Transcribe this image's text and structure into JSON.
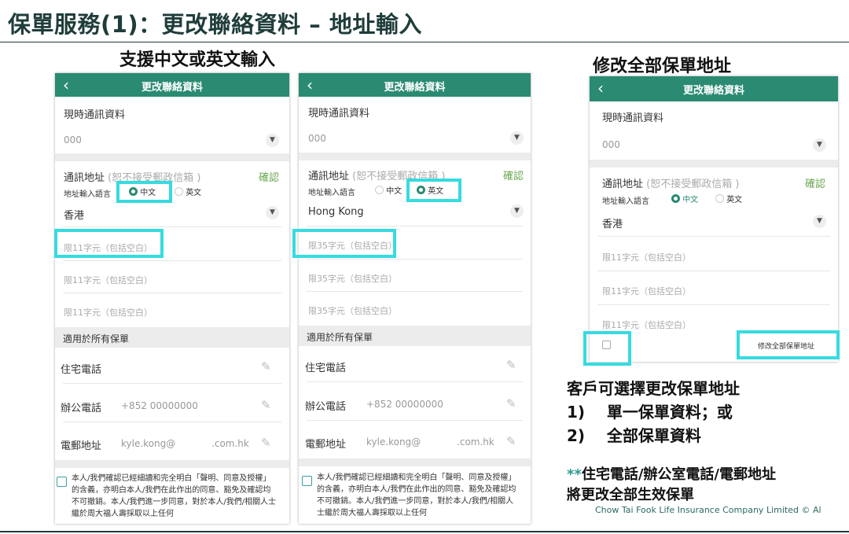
{
  "slide_title": "保單服務(1)：更改聯絡資料 – 地址輸入",
  "captions": {
    "left": "支援中文或英文輸入",
    "right": "修改全部保單地址"
  },
  "app": {
    "header_title": "更改聯絡資料",
    "back_icon": "chevron-left-icon",
    "current_info_label": "現時通訊資料",
    "current_info_value": "000",
    "address_label": "通訊地址",
    "address_note": "(恕不接受郵政信箱 )",
    "confirm": "確認",
    "lang_label": "地址輸入語言",
    "lang_zh": "中文",
    "lang_en": "英文",
    "region_zh": "香港",
    "region_en": "Hong Kong",
    "placeholder_zh": "限11字元（包括空白）",
    "placeholder_en": "限35字元（包括空白）",
    "section_all_policies": "適用於所有保單",
    "home_phone": "住宅電話",
    "office_phone": "辦公電話",
    "office_phone_value": "+852 00000000",
    "email_label": "電郵地址",
    "email_value_user": "kyle.kong@",
    "email_value_domain": ".com.hk",
    "consent_text": "本人/我們確認已經細讀和完全明白「聲明、同意及授權」的含義，亦明白本人/我們在此作出的同意、豁免及確認均不可撤銷。本人/我們進一步同意，對於本人/我們/相關人士繼於周大福人壽採取以上任何",
    "modify_all_label": "修改全部保單地址",
    "accent_color": "#2a8a72",
    "highlight_color": "#36dbe0"
  },
  "notes": {
    "line1": "客戶可選擇更改保單地址",
    "line2_num": "1)",
    "line2_text": "單一保單資料；或",
    "line3_num": "2)",
    "line3_text": "全部保單資料",
    "note_stars": "**",
    "note_line1": "住宅電話/辦公室電話/電郵地址",
    "note_line2": "將更改全部生效保單"
  },
  "copyright": "Chow Tai Fook Life Insurance Company Limited © Al"
}
